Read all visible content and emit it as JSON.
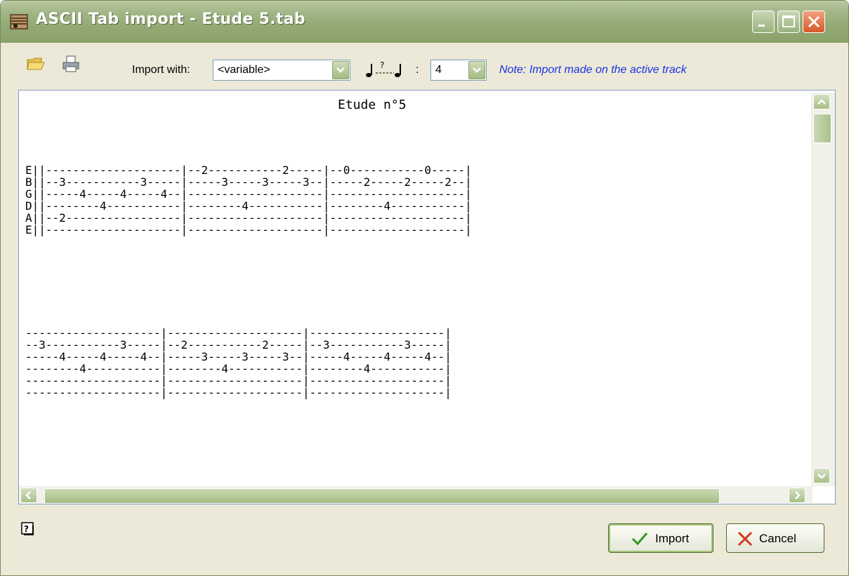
{
  "window": {
    "title": "ASCII Tab import - Etude 5.tab"
  },
  "toolbar": {
    "import_with_label": "Import with:",
    "import_with_value": "<variable>",
    "ratio_colon": ":",
    "ratio_value": "4",
    "note": "Note: Import made on the active track"
  },
  "document": {
    "title": "Etude n°5",
    "system1": [
      "E||--------------------|--2-----------2-----|--0-----------0-----|",
      "B||--3-----------3-----|-----3-----3-----3--|-----2-----2-----2--|",
      "G||-----4-----4-----4--|--------------------|--------------------|",
      "D||--------4-----------|--------4-----------|--------4-----------|",
      "A||--2-----------------|--------------------|--------------------|",
      "E||--------------------|--------------------|--------------------|"
    ],
    "system2": [
      "--------------------|--------------------|--------------------|",
      "--3-----------3-----|--2-----------2-----|--3-----------3-----|",
      "-----4-----4-----4--|-----3-----3-----3--|-----4-----4-----4--|",
      "--------4-----------|--------4-----------|--------4-----------|",
      "--------------------|--------------------|--------------------|",
      "--------------------|--------------------|--------------------|"
    ]
  },
  "buttons": {
    "import": "Import",
    "cancel": "Cancel"
  },
  "icons": [
    "app-icon",
    "open-folder-icon",
    "print-icon",
    "note-ratio-icon",
    "help-icon",
    "checkmark-icon",
    "x-icon"
  ]
}
